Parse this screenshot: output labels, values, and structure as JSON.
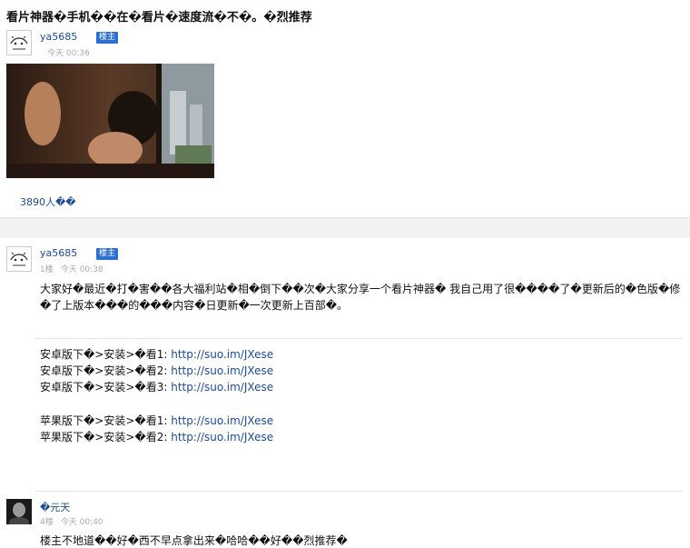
{
  "page": {
    "title": "看片神器�手机��在�看片�速度流�不�。�烈推荐"
  },
  "op_post": {
    "username": "ya5685",
    "badge": "楼主",
    "time": "今天 00:36",
    "views": "3890人��"
  },
  "first_reply": {
    "username": "ya5685",
    "badge": "楼主",
    "floor": "1楼",
    "time": "今天 00:38",
    "body": "大家好�最近�打�害��各大福利站�相�倒下��次�大家分享一个看片神器� 我自己用了很����了�更新后的�色版�修�了上版本���的���内容�日更新�一次更新上百部�。",
    "android_links": [
      {
        "label": "安卓版下�>安装>�看1: ",
        "url": "http://suo.im/JXese"
      },
      {
        "label": "安卓版下�>安装>�看2: ",
        "url": "http://suo.im/JXese"
      },
      {
        "label": "安卓版下�>安装>�看3: ",
        "url": "http://suo.im/JXese"
      }
    ],
    "apple_links": [
      {
        "label": "苹果版下�>安装>�看1: ",
        "url": "http://suo.im/JXese"
      },
      {
        "label": "苹果版下�>安装>�看2: ",
        "url": "http://suo.im/JXese"
      }
    ]
  },
  "second_reply": {
    "username": "�元天",
    "floor": "4楼",
    "time": "今天 00:40",
    "body": "楼主不地道��好�西不早点拿出来�哈哈��好��烈推荐�"
  }
}
